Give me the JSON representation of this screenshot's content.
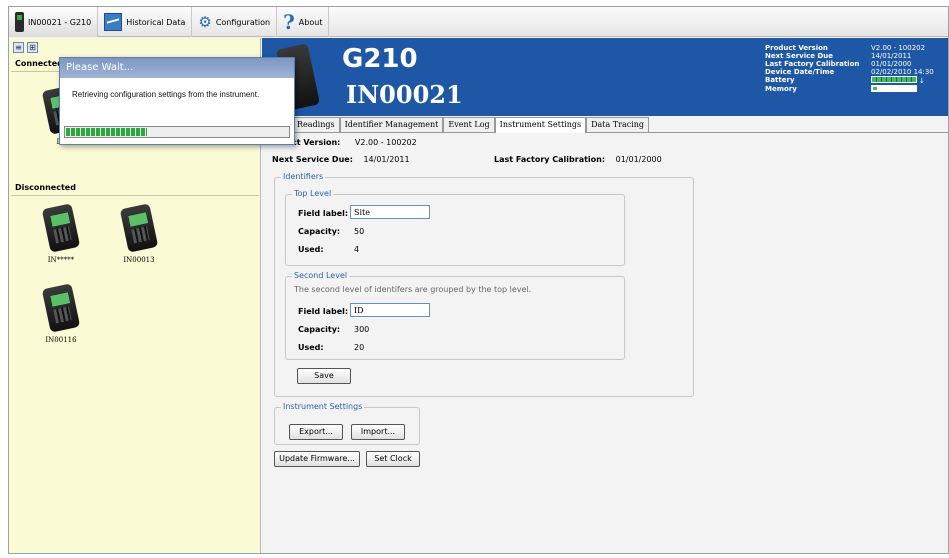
{
  "toolbar": {
    "items": [
      {
        "label": "IN00021 - G210"
      },
      {
        "label": "Historical Data"
      },
      {
        "label": "Configuration"
      },
      {
        "label": "About"
      }
    ]
  },
  "left_panel": {
    "connected_header": "Connected",
    "disconnected_header": "Disconnected",
    "connected_devices": [
      {
        "label": "IN"
      }
    ],
    "disconnected_devices": [
      {
        "label": "IN*****"
      },
      {
        "label": "IN00013"
      },
      {
        "label": "IN00116"
      }
    ]
  },
  "popup": {
    "title": "Please Wait...",
    "message": "Retrieving configuration settings from the instrument.",
    "progress": 0.36
  },
  "banner": {
    "model": "G210",
    "serial": "IN00021",
    "info": [
      {
        "key": "Product Version",
        "value": "V2.00 - 100202"
      },
      {
        "key": "Next Service Due",
        "value": "14/01/2011"
      },
      {
        "key": "Last Factory Calibration",
        "value": "01/01/2000"
      },
      {
        "key": "Device Date/Time",
        "value": "02/02/2010 14:30"
      },
      {
        "key": "Battery",
        "value": ""
      },
      {
        "key": "Memory",
        "value": ""
      }
    ]
  },
  "tabs": [
    {
      "label": "Readings"
    },
    {
      "label": "Identifier Management"
    },
    {
      "label": "Event Log"
    },
    {
      "label": "Instrument Settings",
      "active": true
    },
    {
      "label": "Data Tracing"
    }
  ],
  "main": {
    "product_version_label": "ct Version:",
    "product_version_value": "V2.00 - 100202",
    "next_service_label": "Next Service Due:",
    "next_service_value": "14/01/2011",
    "last_cal_label": "Last Factory Calibration:",
    "last_cal_value": "01/01/2000",
    "identifiers": {
      "title": "Identifiers",
      "top_level": {
        "title": "Top Level",
        "field_label_label": "Field label:",
        "field_label_value": "Site",
        "capacity_label": "Capacity:",
        "capacity_value": "50",
        "used_label": "Used:",
        "used_value": "4"
      },
      "second_level": {
        "title": "Second Level",
        "hint": "The second level of identifers are grouped by the top level.",
        "field_label_label": "Field label:",
        "field_label_value": "ID",
        "capacity_label": "Capacity:",
        "capacity_value": "300",
        "used_label": "Used:",
        "used_value": "20"
      },
      "save_label": "Save"
    },
    "instrument_settings": {
      "title": "Instrument Settings",
      "export_label": "Export...",
      "import_label": "Import..."
    },
    "update_firmware_label": "Update Firmware...",
    "set_clock_label": "Set Clock"
  }
}
